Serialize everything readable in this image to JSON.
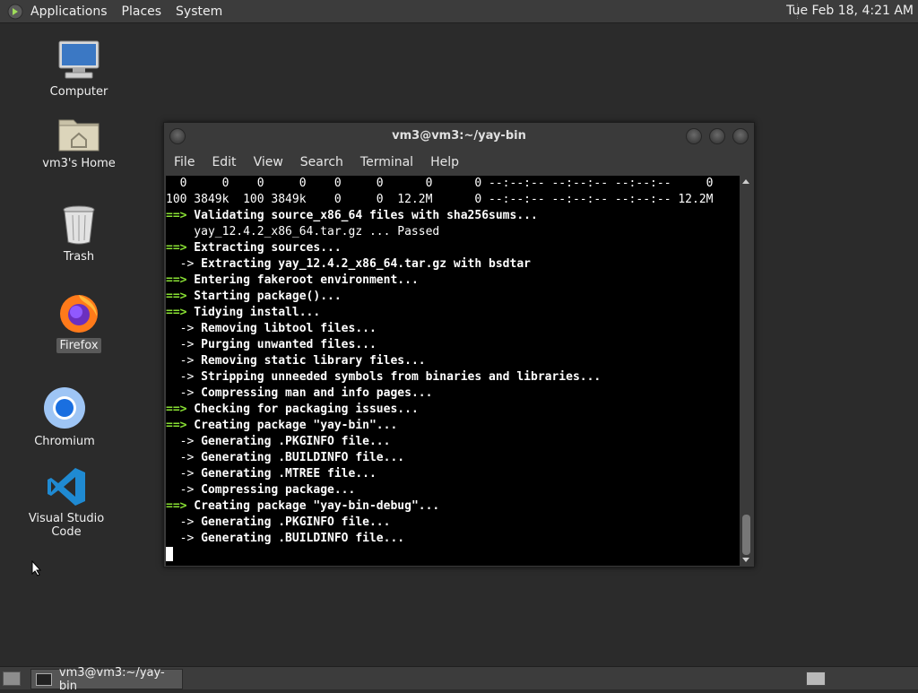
{
  "top_panel": {
    "menus": [
      "Applications",
      "Places",
      "System"
    ],
    "clock": "Tue Feb 18,  4:21 AM"
  },
  "desktop": {
    "icons": [
      {
        "label": "Computer",
        "icon": "computer-icon"
      },
      {
        "label": "vm3's Home",
        "icon": "home-folder-icon"
      },
      {
        "label": "Trash",
        "icon": "trash-icon"
      },
      {
        "label": "Firefox",
        "icon": "firefox-icon"
      },
      {
        "label": "Chromium",
        "icon": "chromium-icon"
      },
      {
        "label": "Visual Studio Code",
        "icon": "vscode-icon"
      }
    ]
  },
  "terminal": {
    "title": "vm3@vm3:~/yay-bin",
    "menu": [
      "File",
      "Edit",
      "View",
      "Search",
      "Terminal",
      "Help"
    ],
    "lines": [
      {
        "prefix": "",
        "text": "  0     0    0     0    0     0      0      0 --:--:-- --:--:-- --:--:--     0",
        "style": "plain"
      },
      {
        "prefix": "",
        "text": "100 3849k  100 3849k    0     0  12.2M      0 --:--:-- --:--:-- --:--:-- 12.2M",
        "style": "plain"
      },
      {
        "prefix": "==>",
        "text": " Validating source_x86_64 files with sha256sums...",
        "style": "green"
      },
      {
        "prefix": "",
        "text": "    yay_12.4.2_x86_64.tar.gz ... Passed",
        "style": "plain"
      },
      {
        "prefix": "==>",
        "text": " Extracting sources...",
        "style": "green"
      },
      {
        "prefix": "  ->",
        "text": " Extracting yay_12.4.2_x86_64.tar.gz with bsdtar",
        "style": "blue"
      },
      {
        "prefix": "==>",
        "text": " Entering fakeroot environment...",
        "style": "green"
      },
      {
        "prefix": "==>",
        "text": " Starting package()...",
        "style": "green"
      },
      {
        "prefix": "==>",
        "text": " Tidying install...",
        "style": "green"
      },
      {
        "prefix": "  ->",
        "text": " Removing libtool files...",
        "style": "blue"
      },
      {
        "prefix": "  ->",
        "text": " Purging unwanted files...",
        "style": "blue"
      },
      {
        "prefix": "  ->",
        "text": " Removing static library files...",
        "style": "blue"
      },
      {
        "prefix": "  ->",
        "text": " Stripping unneeded symbols from binaries and libraries...",
        "style": "blue"
      },
      {
        "prefix": "  ->",
        "text": " Compressing man and info pages...",
        "style": "blue"
      },
      {
        "prefix": "==>",
        "text": " Checking for packaging issues...",
        "style": "green"
      },
      {
        "prefix": "==>",
        "text": " Creating package \"yay-bin\"...",
        "style": "green"
      },
      {
        "prefix": "  ->",
        "text": " Generating .PKGINFO file...",
        "style": "blue"
      },
      {
        "prefix": "  ->",
        "text": " Generating .BUILDINFO file...",
        "style": "blue"
      },
      {
        "prefix": "  ->",
        "text": " Generating .MTREE file...",
        "style": "blue"
      },
      {
        "prefix": "  ->",
        "text": " Compressing package...",
        "style": "blue"
      },
      {
        "prefix": "==>",
        "text": " Creating package \"yay-bin-debug\"...",
        "style": "green"
      },
      {
        "prefix": "  ->",
        "text": " Generating .PKGINFO file...",
        "style": "blue"
      },
      {
        "prefix": "  ->",
        "text": " Generating .BUILDINFO file...",
        "style": "blue"
      }
    ]
  },
  "taskbar": {
    "window_button": "vm3@vm3:~/yay-bin"
  }
}
